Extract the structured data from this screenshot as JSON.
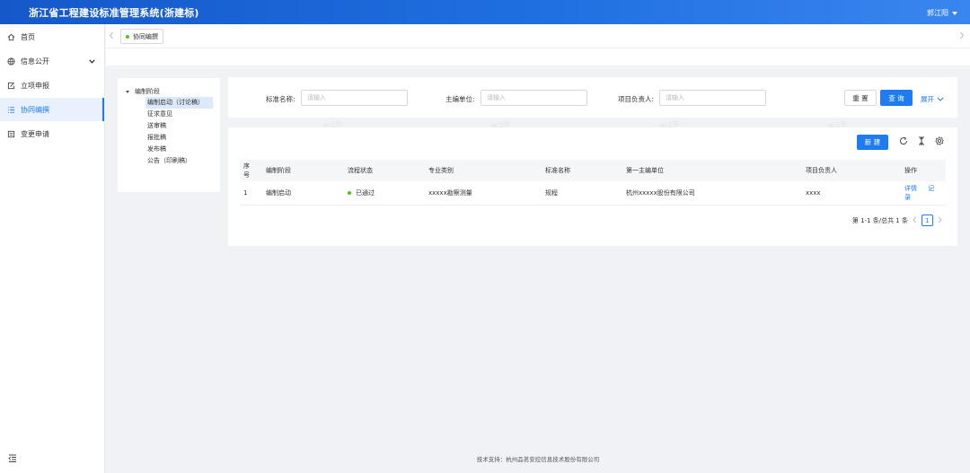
{
  "header": {
    "title": "浙江省工程建设标准管理系统(浙建标)",
    "user": "郭江阳"
  },
  "sidebar": {
    "items": [
      {
        "label": "首页",
        "icon": "home-icon"
      },
      {
        "label": "信息公开",
        "icon": "globe-icon"
      },
      {
        "label": "立项申报",
        "icon": "edit-icon"
      },
      {
        "label": "协同编撰",
        "icon": "list-icon"
      },
      {
        "label": "变更申请",
        "icon": "document-icon"
      }
    ]
  },
  "tabs": [
    {
      "label": "协同编撰"
    }
  ],
  "tree": {
    "root": "编制阶段",
    "nodes": [
      "编制启动（讨论稿）",
      "征求意见",
      "送审稿",
      "报批稿",
      "发布稿",
      "公告（印刷稿）"
    ]
  },
  "search": {
    "fields": [
      {
        "label": "标准名称:",
        "placeholder": "请输入"
      },
      {
        "label": "主编单位:",
        "placeholder": "请输入"
      },
      {
        "label": "项目负责人:",
        "placeholder": "请输入"
      }
    ],
    "reset": "重 置",
    "query": "查 询",
    "expand": "展开"
  },
  "watermark": "郭江阳",
  "toolbar": {
    "new": "新 建"
  },
  "table": {
    "headers": [
      "序号",
      "编制阶段",
      "流程状态",
      "专业类别",
      "标准名称",
      "第一主编单位",
      "项目负责人",
      "操作"
    ],
    "rows": [
      [
        "1",
        "编制启动",
        "已通过",
        "xxxxx勘察测量",
        "规程",
        "杭州xxxxx股份有限公司",
        "xxxx"
      ]
    ],
    "actions": [
      "详情",
      "记录"
    ]
  },
  "pagination": {
    "summary": "第 1-1 条/总共 1 条",
    "current": "1"
  },
  "footer": "技术支持：杭州品茗安控信息技术股份有限公司",
  "colors": {
    "primary": "#1f7cf0",
    "success": "#52c41a",
    "header_start": "#1558c9",
    "header_end": "#3a86f0"
  }
}
